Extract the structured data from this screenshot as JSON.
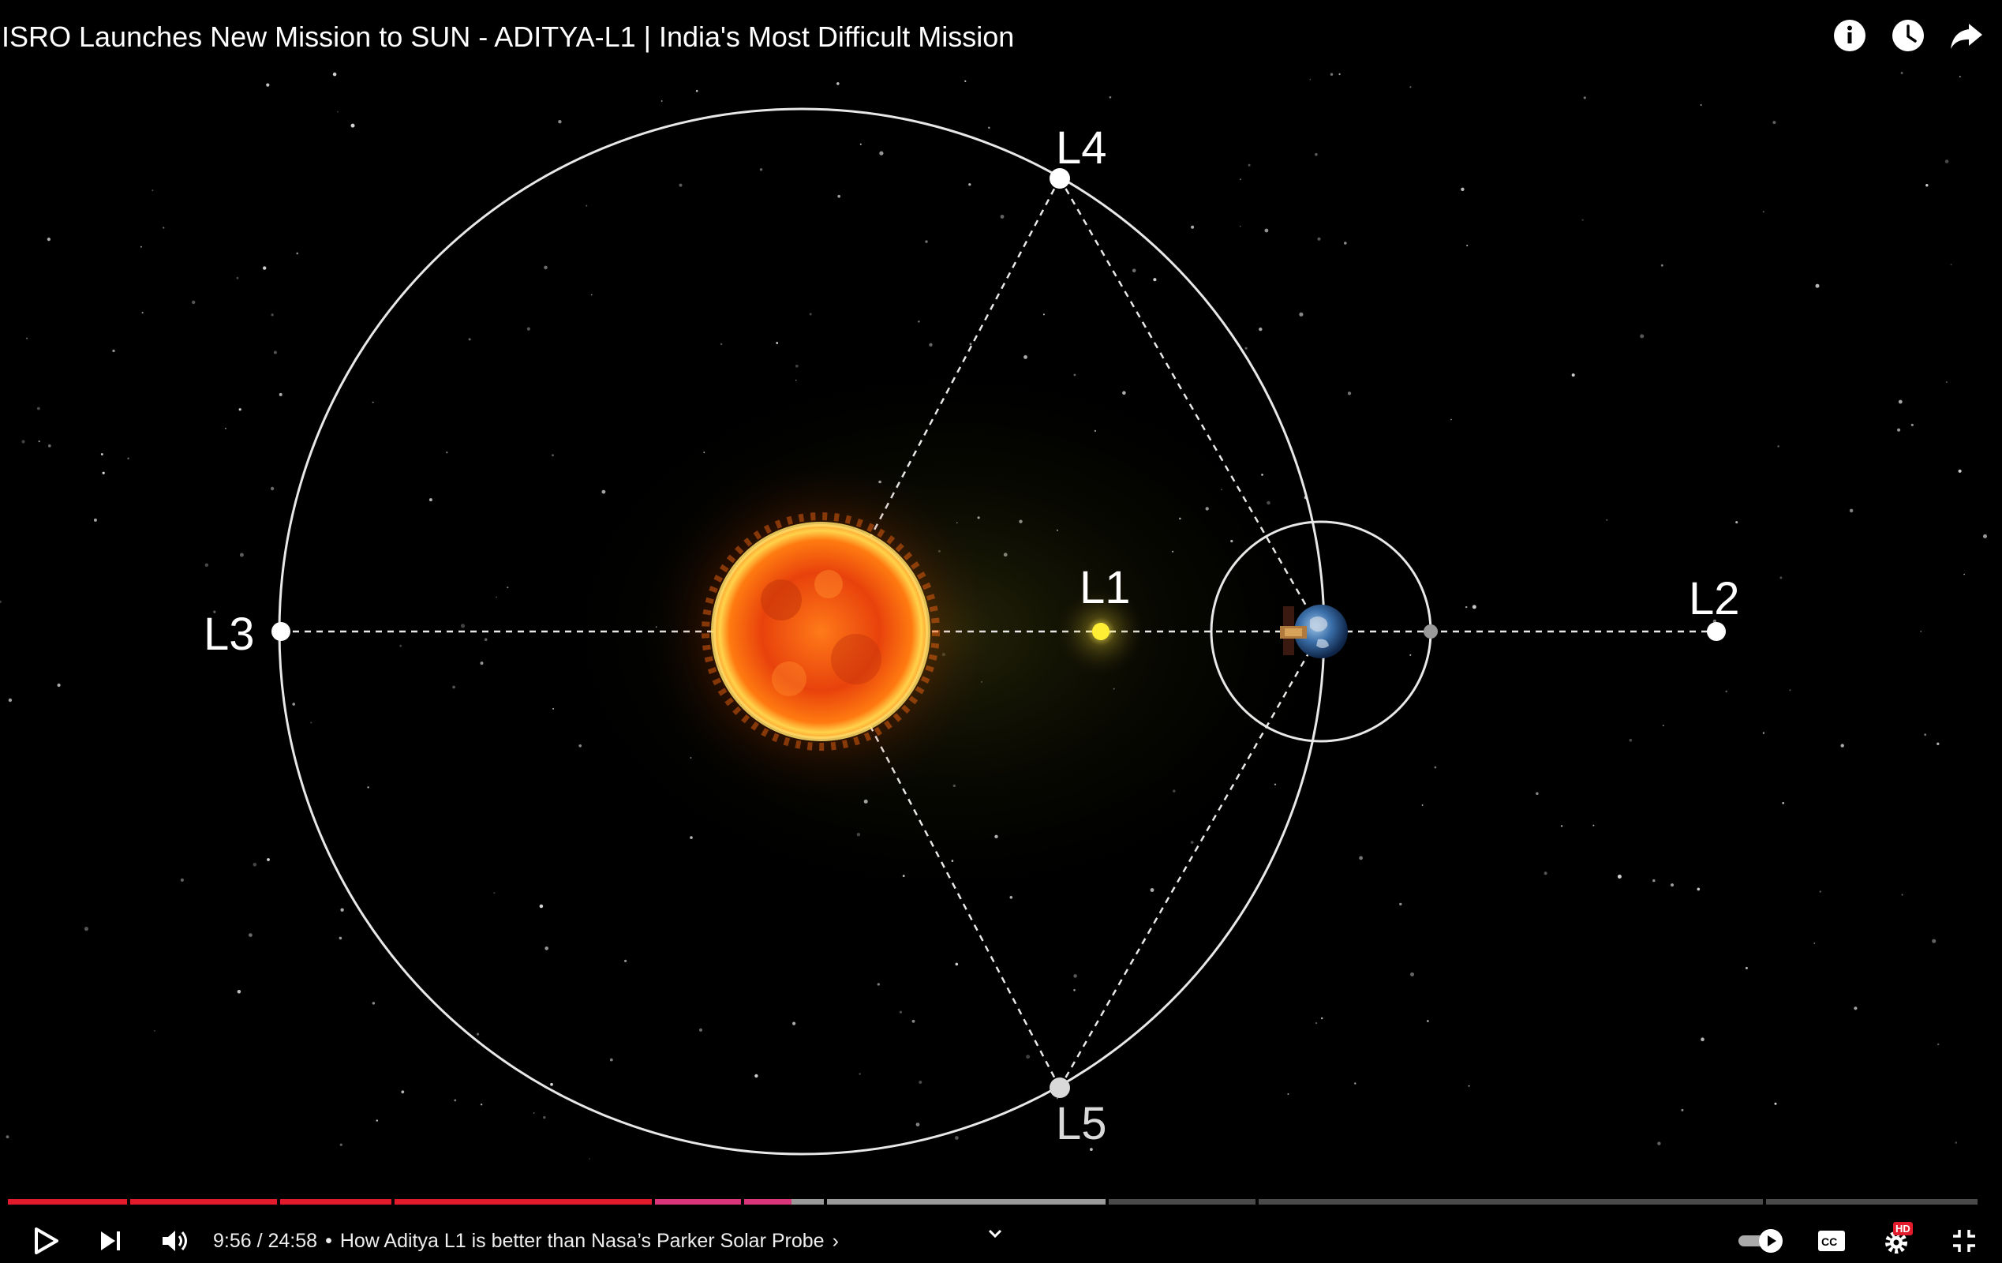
{
  "video": {
    "title": "ISRO Launches New Mission to SUN - ADITYA-L1 | India's Most Difficult Mission"
  },
  "diagram": {
    "labels": {
      "l1": "L1",
      "l2": "L2",
      "l3": "L3",
      "l4": "L4",
      "l5": "L5"
    }
  },
  "player": {
    "current_time": "9:56",
    "duration": "24:58",
    "time_display": "9:56 / 24:58",
    "chapter_separator": "•",
    "chapter_title": "How Aditya L1 is better than Nasa’s Parker Solar Probe",
    "chapter_arrow": "›",
    "progress_fraction": 0.398,
    "buffered_fraction": 0.42,
    "hd_badge": "HD",
    "colors": {
      "played": "#e21b2c",
      "played_pink": "#d9357a",
      "buffered": "#9a9a9a",
      "unplayed": "#4a4a4a"
    }
  },
  "icons": {
    "info": "info-icon",
    "watch_later": "clock-icon",
    "share": "share-icon",
    "play": "play-icon",
    "next": "next-icon",
    "volume": "volume-icon",
    "autoplay": "autoplay-toggle-icon",
    "captions": "captions-icon",
    "settings": "gear-icon",
    "exit_fullscreen": "exit-fullscreen-icon"
  }
}
